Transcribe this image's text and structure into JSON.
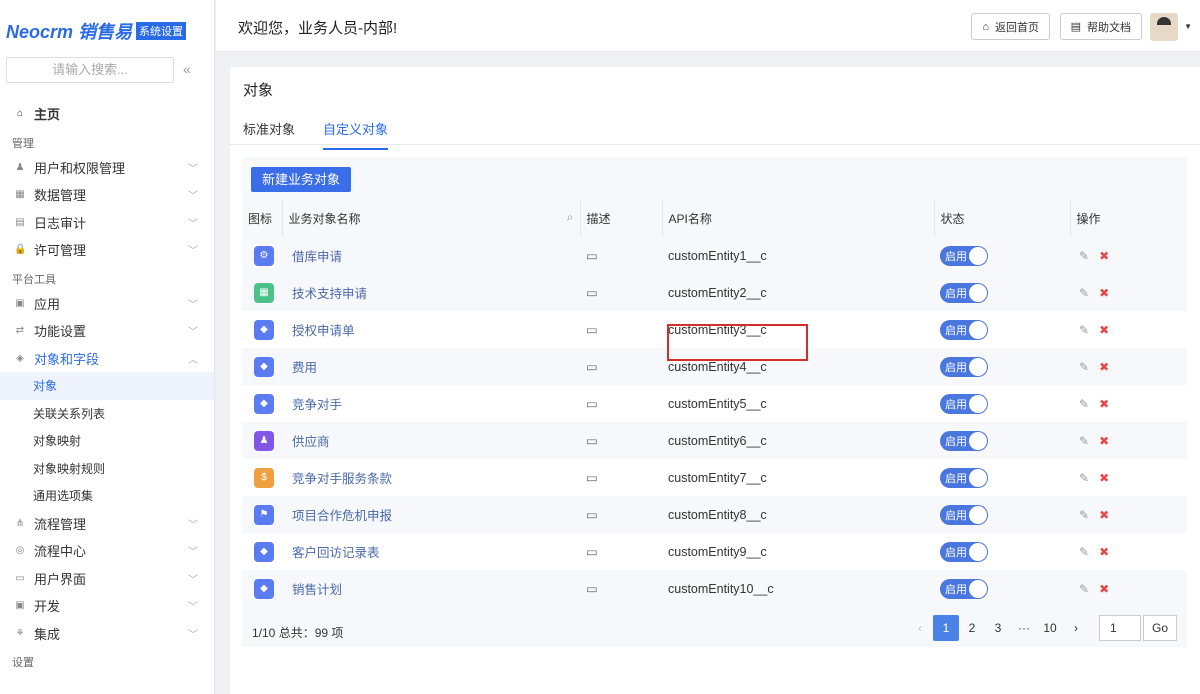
{
  "logo": {
    "brand": "Neocrm 销售易",
    "badge": "系统设置"
  },
  "search": {
    "placeholder": "请输入搜索..."
  },
  "nav": {
    "home": "主页",
    "group_manage": "管理",
    "manage": [
      "用户和权限管理",
      "数据管理",
      "日志审计",
      "许可管理"
    ],
    "group_tools": "平台工具",
    "tools": [
      "应用",
      "功能设置",
      "对象和字段"
    ],
    "sub": [
      "对象",
      "关联关系列表",
      "对象映射",
      "对象映射规则",
      "通用选项集"
    ],
    "more": [
      "流程管理",
      "流程中心",
      "用户界面",
      "开发",
      "集成"
    ],
    "group_settings": "设置"
  },
  "header": {
    "welcome": "欢迎您，业务人员-内部!",
    "home_btn": "返回首页",
    "help_btn": "帮助文档"
  },
  "page": {
    "title": "对象",
    "tabs": [
      "标准对象",
      "自定义对象"
    ],
    "new_btn": "新建业务对象"
  },
  "table": {
    "columns": [
      "图标",
      "业务对象名称",
      "描述",
      "API名称",
      "状态",
      "操作"
    ],
    "status_label": "启用",
    "rows": [
      {
        "name": "借库申请",
        "api": "customEntity1__c",
        "color": "#5b7cf0",
        "icon": "gear-icon"
      },
      {
        "name": "技术支持申请",
        "api": "customEntity2__c",
        "color": "#4cc28a",
        "icon": "calendar-icon"
      },
      {
        "name": "授权申请单",
        "api": "customEntity3__c",
        "color": "#5b7cf0",
        "icon": "puzzle-icon"
      },
      {
        "name": "费用",
        "api": "customEntity4__c",
        "color": "#5b7cf0",
        "icon": "puzzle-icon"
      },
      {
        "name": "竞争对手",
        "api": "customEntity5__c",
        "color": "#5b7cf0",
        "icon": "puzzle-icon"
      },
      {
        "name": "供应商",
        "api": "customEntity6__c",
        "color": "#8257e6",
        "icon": "users-icon"
      },
      {
        "name": "竞争对手服务条款",
        "api": "customEntity7__c",
        "color": "#f0a040",
        "icon": "coin-icon"
      },
      {
        "name": "项目合作危机申报",
        "api": "customEntity8__c",
        "color": "#5b7cf0",
        "icon": "flag-icon"
      },
      {
        "name": "客户回访记录表",
        "api": "customEntity9__c",
        "color": "#5b7cf0",
        "icon": "puzzle-icon"
      },
      {
        "name": "销售计划",
        "api": "customEntity10__c",
        "color": "#5b7cf0",
        "icon": "puzzle-icon"
      }
    ]
  },
  "footer": {
    "summary": "1/10 总共：99 项"
  },
  "pager": {
    "pages": [
      "1",
      "2",
      "3",
      "···",
      "10"
    ],
    "current": "1",
    "go_value": "1",
    "go_label": "Go"
  }
}
